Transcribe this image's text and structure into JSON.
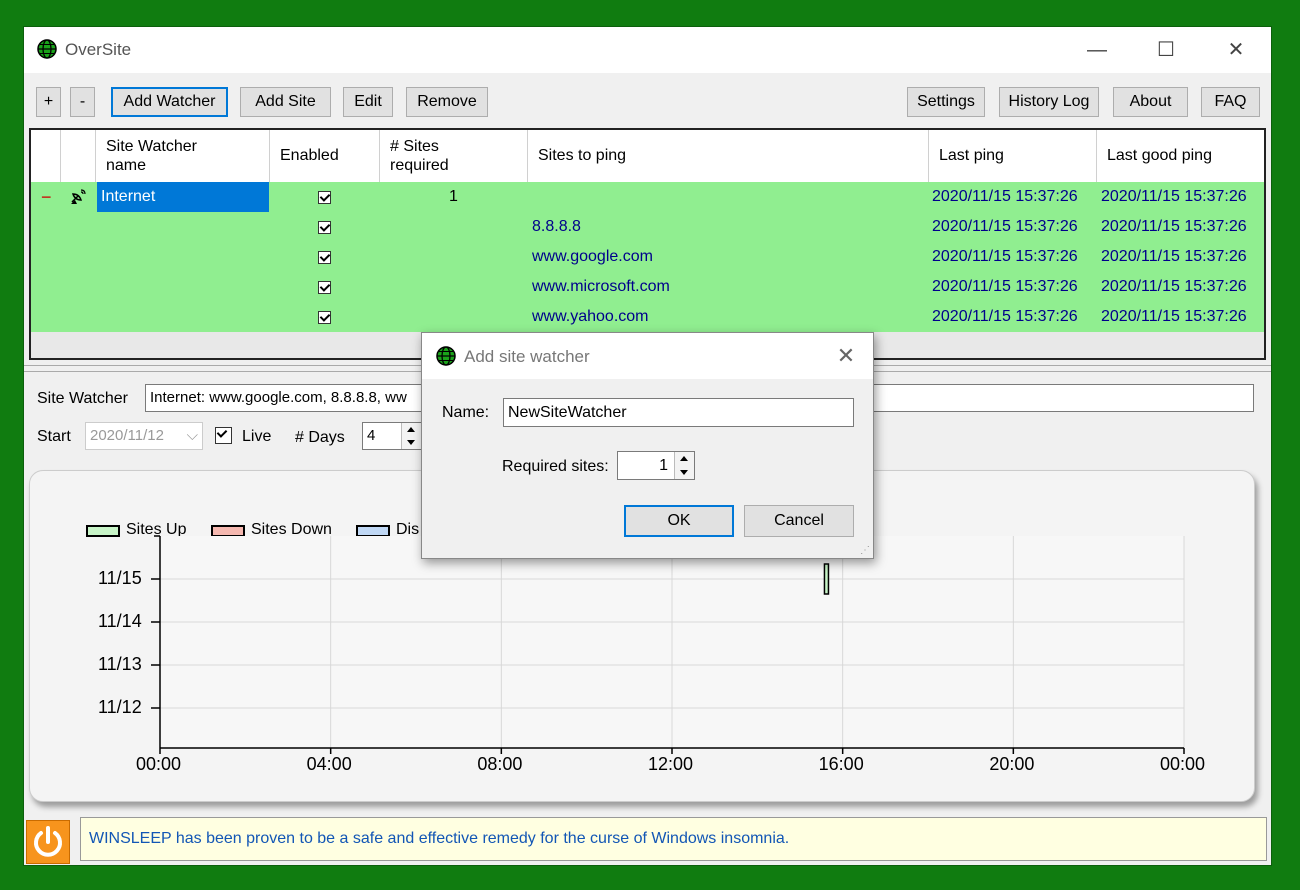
{
  "window": {
    "title": "OverSite",
    "controls": {
      "minimize": "—",
      "maximize": "☐",
      "close": "✕"
    }
  },
  "toolbar": {
    "expand_label": "+",
    "collapse_label": "-",
    "add_watcher_label": "Add Watcher",
    "add_site_label": "Add Site",
    "edit_label": "Edit",
    "remove_label": "Remove",
    "settings_label": "Settings",
    "history_label": "History Log",
    "about_label": "About",
    "faq_label": "FAQ"
  },
  "grid": {
    "headers": {
      "name_line1": "Site Watcher",
      "name_line2": "name",
      "enabled": "Enabled",
      "required_line1": "# Sites",
      "required_line2": "required",
      "sites": "Sites to ping",
      "last_ping": "Last ping",
      "last_good": "Last good ping"
    },
    "collapse_glyph": "−",
    "watcher": {
      "name": "Internet",
      "required": "1",
      "last_ping": "2020/11/15 15:37:26",
      "last_good": "2020/11/15 15:37:26",
      "enabled": true
    },
    "sites": [
      {
        "site": "8.8.8.8",
        "last_ping": "2020/11/15 15:37:26",
        "last_good": "2020/11/15 15:37:26",
        "enabled": true
      },
      {
        "site": "www.google.com",
        "last_ping": "2020/11/15 15:37:26",
        "last_good": "2020/11/15 15:37:26",
        "enabled": true
      },
      {
        "site": "www.microsoft.com",
        "last_ping": "2020/11/15 15:37:26",
        "last_good": "2020/11/15 15:37:26",
        "enabled": true
      },
      {
        "site": "www.yahoo.com",
        "last_ping": "2020/11/15 15:37:26",
        "last_good": "2020/11/15 15:37:26",
        "enabled": true
      }
    ]
  },
  "filters": {
    "site_watcher_label": "Site Watcher",
    "site_watcher_value": "Internet: www.google.com, 8.8.8.8, ww",
    "start_label": "Start",
    "start_value": "2020/11/12",
    "live_label": "Live",
    "live_checked": true,
    "days_label": "# Days",
    "days_value": "4"
  },
  "chart_data": {
    "type": "scatter",
    "legend": [
      "Sites Up",
      "Sites Down",
      "Dis"
    ],
    "legend_colors": [
      "#c8f5c8",
      "#f5b8b0",
      "#c0d8f5"
    ],
    "x_ticks": [
      "00:00",
      "04:00",
      "08:00",
      "12:00",
      "16:00",
      "20:00",
      "00:00"
    ],
    "y_ticks": [
      "11/15",
      "11/14",
      "11/13",
      "11/12"
    ],
    "xlim": [
      0,
      24
    ],
    "ylim": [
      "11/12",
      "11/15"
    ],
    "grid": true,
    "legend_position": "top-left",
    "marks": [
      {
        "x": 15.62,
        "y": "11/15",
        "series": "Sites Up"
      }
    ]
  },
  "status": {
    "message": "WINSLEEP has been proven to be a safe and effective remedy for the curse of Windows insomnia."
  },
  "dialog": {
    "title": "Add site watcher",
    "name_label": "Name:",
    "name_value": "NewSiteWatcher",
    "required_label": "Required sites:",
    "required_value": "1",
    "ok_label": "OK",
    "cancel_label": "Cancel"
  }
}
